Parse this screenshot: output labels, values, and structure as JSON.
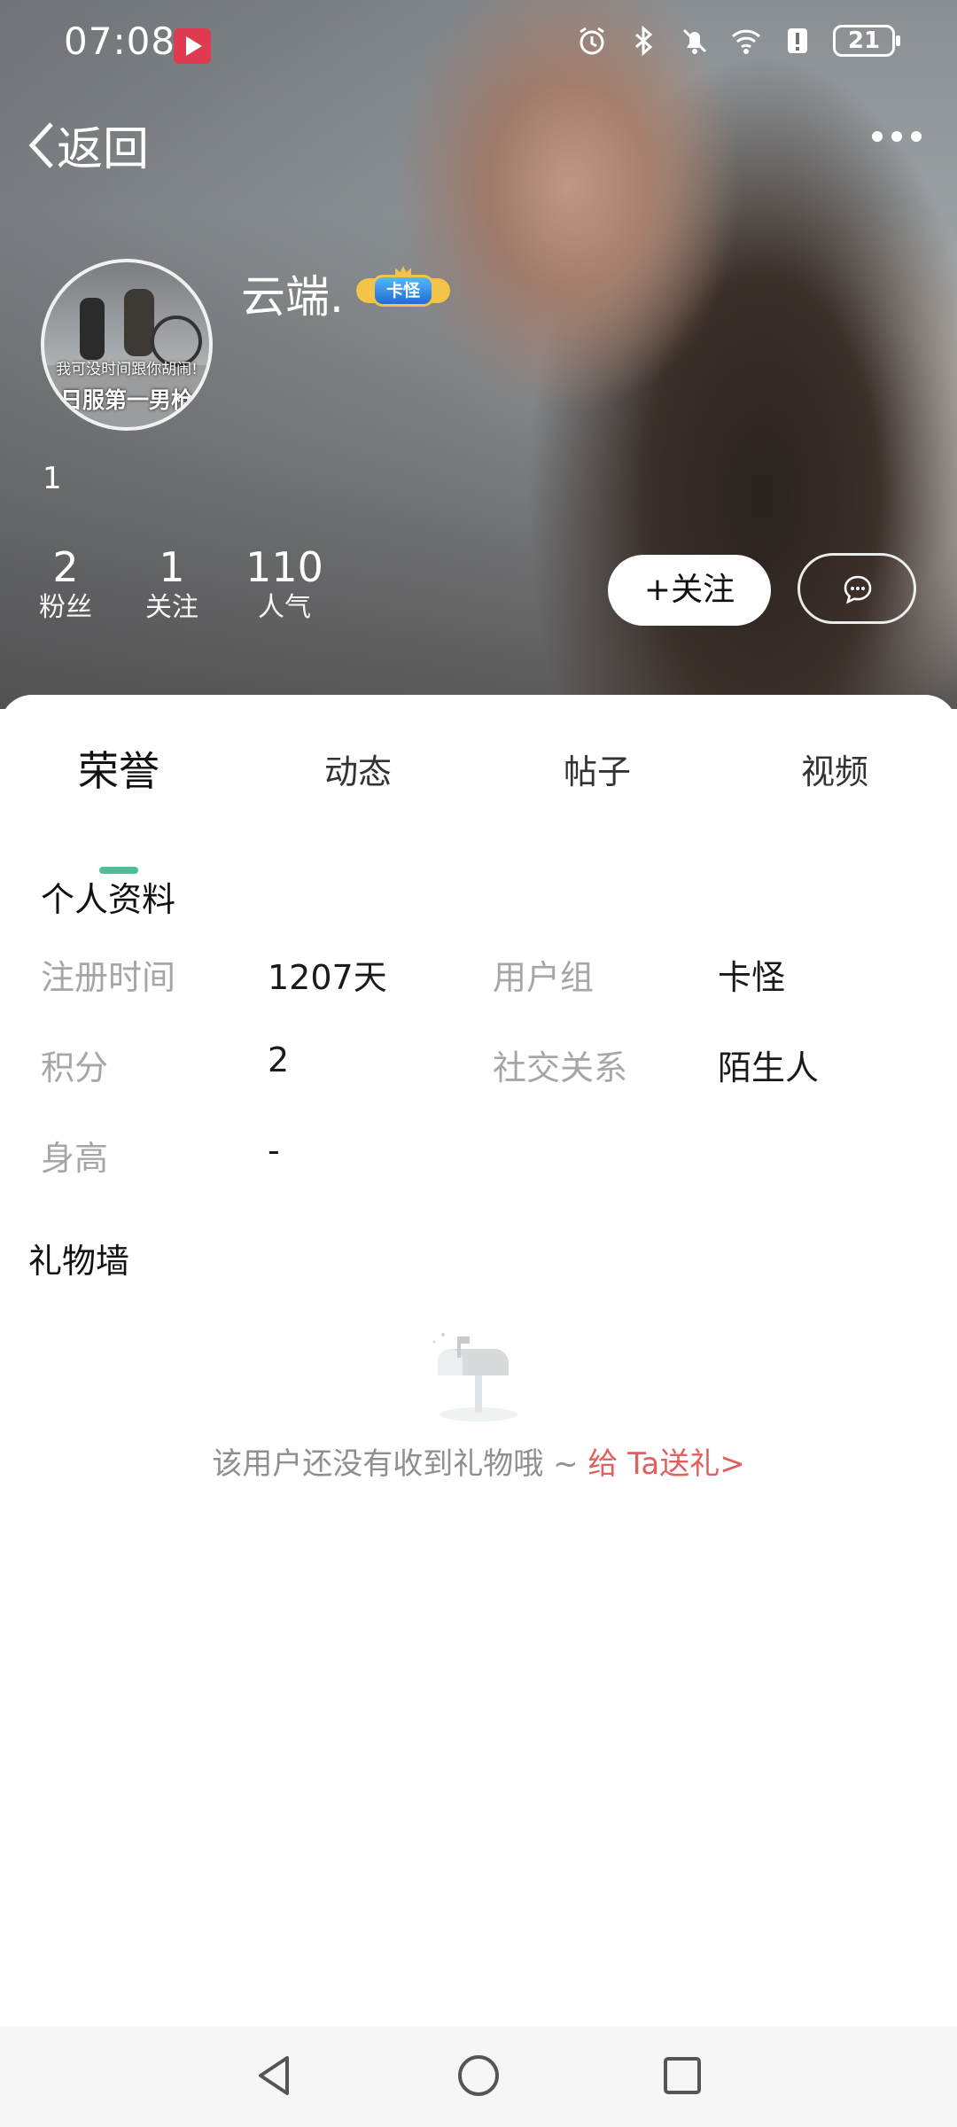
{
  "status": {
    "time": "07:08",
    "battery": "21"
  },
  "nav": {
    "back_label": "返回"
  },
  "profile": {
    "username": "云端.",
    "badge_label": "卡怪",
    "avatar_caption_top": "我可没时间跟你胡闹!",
    "avatar_caption_bottom": "日服第一男枪",
    "signature": "1",
    "stats": [
      {
        "value": "2",
        "label": "粉丝"
      },
      {
        "value": "1",
        "label": "关注"
      },
      {
        "value": "110",
        "label": "人气"
      }
    ],
    "follow_label": "+关注"
  },
  "tabs": [
    {
      "label": "荣誉",
      "active": true
    },
    {
      "label": "动态",
      "active": false
    },
    {
      "label": "帖子",
      "active": false
    },
    {
      "label": "视频",
      "active": false
    }
  ],
  "personal_info": {
    "title": "个人资料",
    "rows": [
      {
        "k1": "注册时间",
        "v1": "1207天",
        "k2": "用户组",
        "v2": "卡怪"
      },
      {
        "k1": "积分",
        "v1": "2",
        "k2": "社交关系",
        "v2": "陌生人"
      },
      {
        "k1": "身高",
        "v1": "-",
        "k2": "",
        "v2": ""
      }
    ]
  },
  "gift_wall": {
    "title": "礼物墙",
    "empty_text": "该用户还没有收到礼物哦 ~ ",
    "send_link": "给 Ta送礼>"
  },
  "colors": {
    "accent_green": "#4cbf96",
    "link_red": "#e0605e"
  }
}
